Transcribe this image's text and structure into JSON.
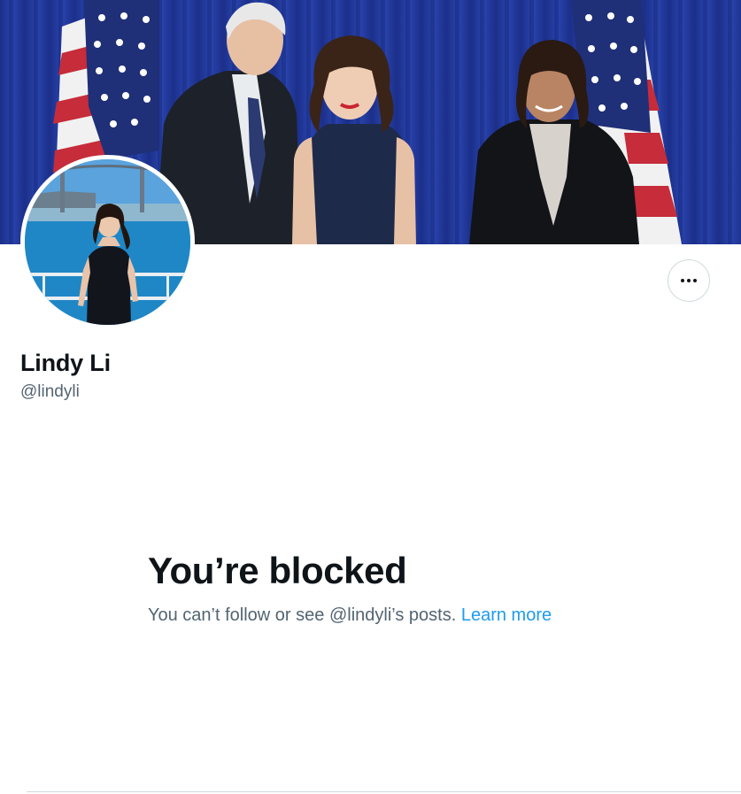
{
  "profile": {
    "display_name": "Lindy Li",
    "handle": "@lindyli"
  },
  "actions": {
    "more_icon": "more-horizontal-icon"
  },
  "blocked": {
    "title": "You’re blocked",
    "message": "You can’t follow or see @lindyli’s posts.",
    "link_label": "Learn more"
  },
  "colors": {
    "text_primary": "#0f1419",
    "text_secondary": "#536471",
    "link": "#1d9bf0",
    "border": "#cfd9de"
  }
}
